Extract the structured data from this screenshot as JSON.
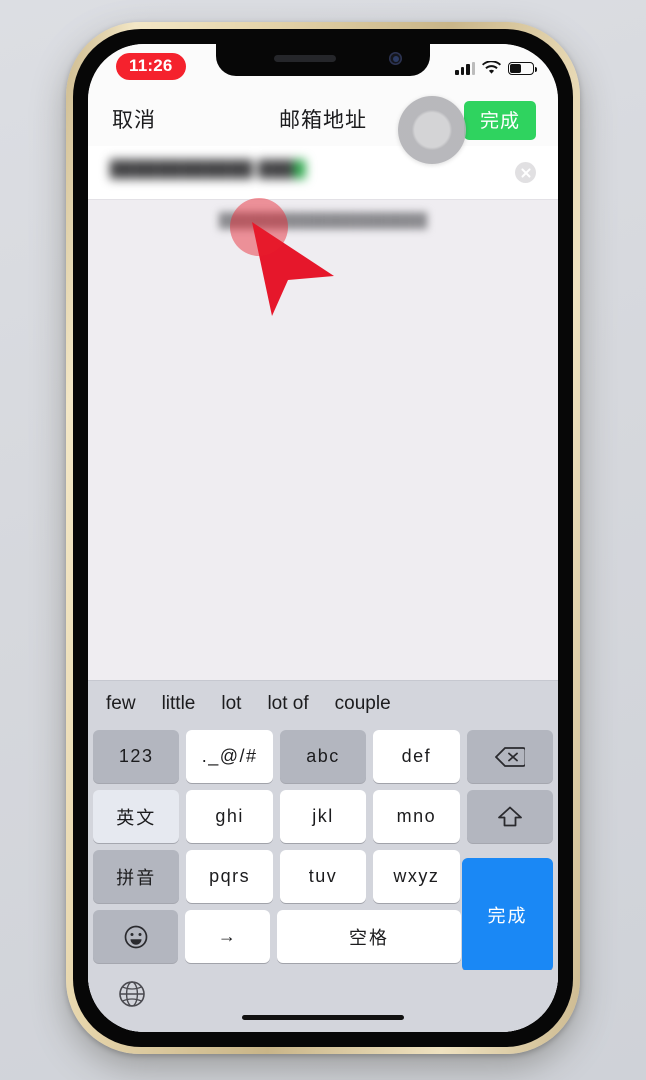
{
  "device": {
    "name": "iphone",
    "frame_color": "#e2d3ae",
    "screen_bg": "#efedf1"
  },
  "status_bar": {
    "time": "11:26",
    "time_pill_color": "#f5222d",
    "signal_icon": "cellular-signal-icon",
    "wifi_icon": "wifi-icon",
    "battery_icon": "battery-icon"
  },
  "nav_bar": {
    "cancel_label": "取消",
    "title": "邮箱地址",
    "done_label": "完成",
    "done_color": "#2fd35f"
  },
  "overlay": {
    "assistive_touch_icon": "assistive-touch-icon"
  },
  "form": {
    "email_value": "████████████ ███",
    "email_value_suffix": "█",
    "clear_icon": "clear-circle-icon",
    "hint_text": "█████████████████████"
  },
  "cursor": {
    "icon": "red-arrow-cursor",
    "color": "#e6172b",
    "halo_color": "rgba(233,30,45,0.45)"
  },
  "keyboard": {
    "suggestions": [
      "few",
      "little",
      "lot",
      "lot of",
      "couple"
    ],
    "rows": [
      [
        {
          "label": "123",
          "style": "fn"
        },
        {
          "label": "._@/#",
          "style": "normal"
        },
        {
          "label": "abc",
          "style": "fn"
        },
        {
          "label": "def",
          "style": "normal"
        },
        {
          "label": "backspace-icon",
          "style": "fn",
          "icon": "backspace-icon"
        }
      ],
      [
        {
          "label": "英文",
          "style": "fn-lite"
        },
        {
          "label": "ghi",
          "style": "normal"
        },
        {
          "label": "jkl",
          "style": "normal"
        },
        {
          "label": "mno",
          "style": "normal"
        },
        {
          "label": "shift-icon",
          "style": "fn",
          "icon": "shift-icon"
        }
      ],
      [
        {
          "label": "拼音",
          "style": "fn"
        },
        {
          "label": "pqrs",
          "style": "normal"
        },
        {
          "label": "tuv",
          "style": "normal"
        },
        {
          "label": "wxyz",
          "style": "normal"
        }
      ],
      [
        {
          "label": "emoji-icon",
          "style": "fn",
          "icon": "emoji-icon"
        },
        {
          "label": "→",
          "style": "normal"
        },
        {
          "label": "空格",
          "style": "normal",
          "wide": true
        }
      ]
    ],
    "done_key_label": "完成",
    "done_key_color": "#1a88f5",
    "globe_icon": "globe-icon"
  }
}
